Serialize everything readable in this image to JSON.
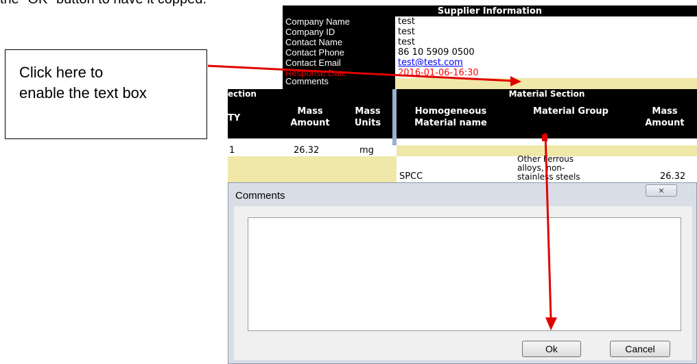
{
  "caption": {
    "top_text": "the \"OK\" button to have it copped."
  },
  "callout": {
    "line1": "Click here to",
    "line2": "enable the text box"
  },
  "supplier": {
    "title": "Supplier Information",
    "rows": [
      {
        "label": "Company Name",
        "value": "test"
      },
      {
        "label": "Company ID",
        "value": "test"
      },
      {
        "label": "Contact Name",
        "value": "test"
      },
      {
        "label": "Contact Phone",
        "value": "86 10 5909 0500"
      },
      {
        "label": "Contact Email",
        "value": "test@test.com"
      },
      {
        "label": "Response Date",
        "value": "2016-01-06-16:30"
      }
    ],
    "comments_label": "Comments"
  },
  "table": {
    "left_section_title": "ection",
    "right_section_title": "Material Section",
    "headers": {
      "ty": "TY",
      "mass_amount": "Mass Amount",
      "mass_units": "Mass Units",
      "homogeneous": "Homogeneous Material name",
      "material_group": "Material Group",
      "mass_amount_2": "Mass Amount"
    },
    "row1": {
      "qty": "1",
      "mass": "26.32",
      "units": "mg"
    },
    "row2": {
      "material": "SPCC",
      "group": "Other Ferrous alloys, non-stainless steels",
      "mass": "26.32"
    }
  },
  "dialog": {
    "title": "Comments",
    "close_glyph": "✕",
    "textarea_value": "",
    "ok_label": "Ok",
    "cancel_label": "Cancel"
  },
  "colors": {
    "arrow": "#e00000",
    "highlight": "#f0e8a8",
    "link": "#0000ee",
    "date": "#ff0000"
  }
}
